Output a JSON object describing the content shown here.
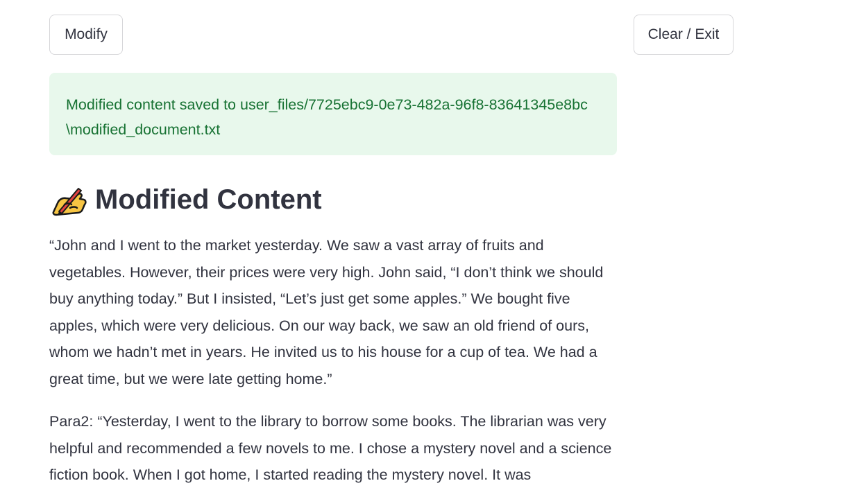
{
  "buttons": {
    "modify_label": "Modify",
    "clear_exit_label": "Clear / Exit"
  },
  "alert": {
    "message": "Modified content saved to user_files/7725ebc9-0e73-482a-96f8-83641345e8bc\\modified_document.txt"
  },
  "content": {
    "heading_icon": "writing-hand-icon",
    "heading": "Modified Content",
    "paragraphs": [
      "“John and I went to the market yesterday. We saw a vast array of fruits and vegetables. However, their prices were very high. John said, “I don’t think we should buy anything today.” But I insisted, “Let’s just get some apples.” We bought five apples, which were very delicious. On our way back, we saw an old friend of ours, whom we hadn’t met in years. He invited us to his house for a cup of tea. We had a great time, but we were late getting home.”",
      "Para2: “Yesterday, I went to the library to borrow some books. The librarian was very helpful and recommended a few novels to me. I chose a mystery novel and a science fiction book. When I got home, I started reading the mystery novel. It was"
    ]
  },
  "colors": {
    "success_bg": "#e8f8ec",
    "success_text": "#177233",
    "text": "#31333f",
    "button_border": "#d6d6d9"
  }
}
